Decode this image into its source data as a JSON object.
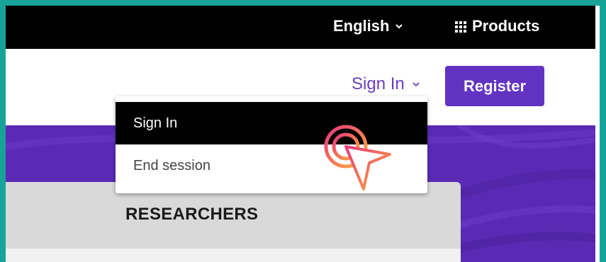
{
  "topbar": {
    "language_label": "English",
    "products_label": "Products"
  },
  "header": {
    "signin_label": "Sign In",
    "register_label": "Register"
  },
  "dropdown": {
    "items": [
      {
        "label": "Sign In",
        "highlighted": true
      },
      {
        "label": "End session",
        "highlighted": false
      }
    ]
  },
  "card": {
    "title": "RESEARCHERS"
  },
  "colors": {
    "accent": "#6233c2",
    "hero": "#5b2ab5",
    "frame": "#17a398"
  },
  "icons": [
    "chevron-down-icon",
    "grid-icon",
    "cursor-click-icon"
  ]
}
